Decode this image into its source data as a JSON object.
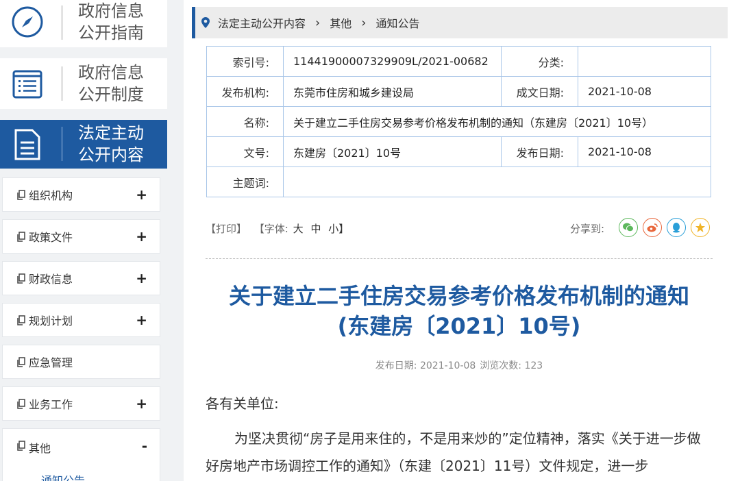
{
  "sidebar": {
    "blocks": [
      {
        "title_line1": "政府信息",
        "title_line2": "公开指南",
        "icon": "compass-icon"
      },
      {
        "title_line1": "政府信息",
        "title_line2": "公开制度",
        "icon": "list-icon"
      },
      {
        "title_line1": "法定主动",
        "title_line2": "公开内容",
        "icon": "document-icon"
      }
    ],
    "menu": [
      {
        "label": "组织机构",
        "toggle": "+"
      },
      {
        "label": "政策文件",
        "toggle": "+"
      },
      {
        "label": "财政信息",
        "toggle": "+"
      },
      {
        "label": "规划计划",
        "toggle": "+"
      },
      {
        "label": "应急管理",
        "toggle": ""
      },
      {
        "label": "业务工作",
        "toggle": "+"
      },
      {
        "label": "其他",
        "toggle": "-"
      }
    ],
    "submenu_active": "通知公告",
    "accent": "#1e5aa0"
  },
  "breadcrumb": [
    "法定主动公开内容",
    "其他",
    "通知公告"
  ],
  "meta": {
    "index_label": "索引号:",
    "index_value": "11441900007329909L/2021-00682",
    "category_label": "分类:",
    "category_value": "",
    "publisher_label": "发布机构:",
    "publisher_value": "东莞市住房和城乡建设局",
    "created_label": "成文日期:",
    "created_value": "2021-10-08",
    "name_label": "名称:",
    "name_value": "关于建立二手住房交易参考价格发布机制的通知（东建房〔2021〕10号）",
    "docno_label": "文号:",
    "docno_value": "东建房〔2021〕10号",
    "pubdate_label": "发布日期:",
    "pubdate_value": "2021-10-08",
    "keywords_label": "主题词:",
    "keywords_value": ""
  },
  "toolbar": {
    "print": "【打印】",
    "font_open": "【字体:",
    "font_large": "大",
    "font_medium": "中",
    "font_small": "小】",
    "share_label": "分享到:",
    "share_icons": [
      "wechat-icon",
      "weibo-icon",
      "qq-icon",
      "qzone-icon"
    ]
  },
  "article": {
    "title_line1": "关于建立二手住房交易参考价格发布机制的通知",
    "title_line2": "(东建房〔2021〕10号)",
    "pubdate": "发布日期: 2021-10-08",
    "views": "浏览次数: 123",
    "salutation": "各有关单位:",
    "paragraph": "为坚决贯彻“房子是用来住的，不是用来炒的”定位精神，落实《关于进一步做好房地产市场调控工作的通知》（东建〔2021〕11号）文件规定，进一步"
  }
}
